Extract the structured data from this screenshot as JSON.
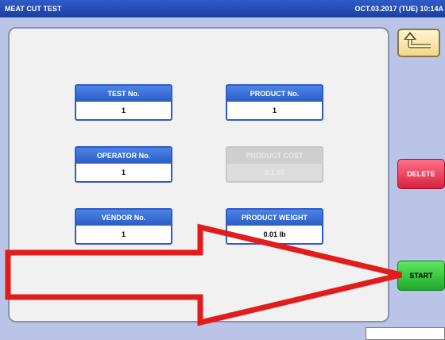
{
  "titlebar": {
    "title": "MEAT CUT TEST",
    "clock": "OCT.03.2017 (TUE) 10:14A"
  },
  "fields": {
    "test_no": {
      "label": "TEST No.",
      "value": "1"
    },
    "product_no": {
      "label": "PRODUCT No.",
      "value": "1"
    },
    "operator_no": {
      "label": "OPERATOR No.",
      "value": "1"
    },
    "product_cost": {
      "label": "PRODUCT COST",
      "value": "$ 1.00"
    },
    "vendor_no": {
      "label": "VENDOR No.",
      "value": "1"
    },
    "product_weight": {
      "label": "PRODUCT WEIGHT",
      "value": "0.01 lb"
    }
  },
  "buttons": {
    "back_icon": "return-arrow-icon",
    "delete": "DELETE",
    "start": "START"
  },
  "colors": {
    "titlebar": "#1c3f9e",
    "card_header": "#2b5dc4",
    "delete": "#d8223f",
    "start": "#1fa82c",
    "annotation_arrow": "#e21b1b"
  }
}
